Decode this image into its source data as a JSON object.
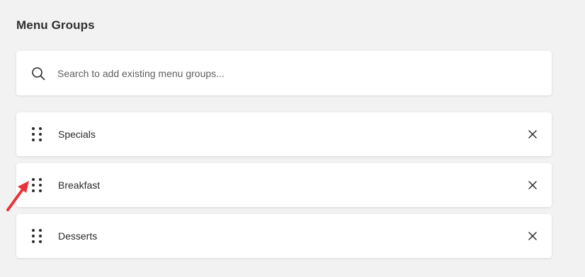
{
  "page": {
    "title": "Menu Groups"
  },
  "search": {
    "placeholder": "Search to add existing menu groups...",
    "icon": "search-icon"
  },
  "groups": [
    {
      "label": "Specials",
      "drag_icon": "drag-handle-icon",
      "remove_icon": "close-icon"
    },
    {
      "label": "Breakfast",
      "drag_icon": "drag-handle-icon",
      "remove_icon": "close-icon"
    },
    {
      "label": "Desserts",
      "drag_icon": "drag-handle-icon",
      "remove_icon": "close-icon"
    }
  ],
  "annotation": {
    "icon": "red-arrow-icon",
    "color": "#e8333c",
    "points_to": "drag-handle of Breakfast"
  },
  "colors": {
    "background": "#f2f2f2",
    "card": "#ffffff",
    "text": "#2b2b2b"
  }
}
